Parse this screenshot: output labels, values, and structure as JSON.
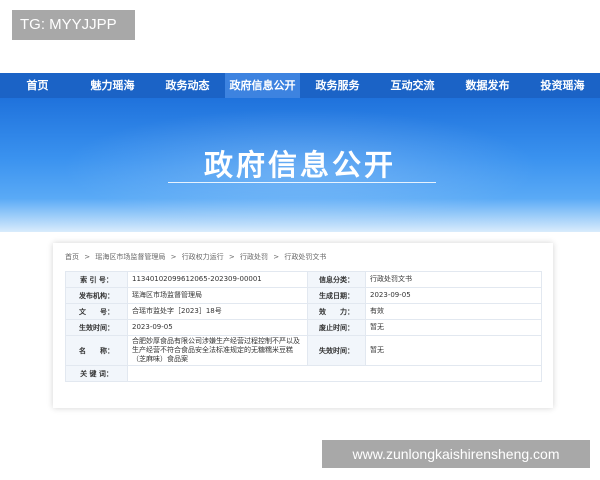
{
  "watermark_top": "TG: MYYJJPP",
  "watermark_bottom": "www.zunlongkaishirensheng.com",
  "nav": [
    "首页",
    "魅力瑶海",
    "政务动态",
    "政府信息公开",
    "政务服务",
    "互动交流",
    "数据发布",
    "投资瑶海"
  ],
  "banner": {
    "title": "政府信息公开"
  },
  "breadcrumb": [
    "首页",
    ">",
    "瑶海区市场监督管理局",
    ">",
    "行政权力运行",
    ">",
    "行政处罚",
    ">",
    "行政处罚文书"
  ],
  "table": {
    "rows": [
      {
        "l1": "索 引 号：",
        "v1": "11340102099612065-202309-00001",
        "l2": "信息分类：",
        "v2": "行政处罚文书"
      },
      {
        "l1": "发布机构：",
        "v1": "瑶海区市场监督管理局",
        "l2": "生成日期：",
        "v2": "2023-09-05"
      },
      {
        "l1": "文　　号：",
        "v1": "合瑶市监处字［2023］18号",
        "l2": "效　　力：",
        "v2": "有效"
      },
      {
        "l1": "生效时间：",
        "v1": "2023-09-05",
        "l2": "废止时间：",
        "v2": "暂无"
      },
      {
        "l1": "名　　称：",
        "v1": "合肥妙厚食品有限公司涉嫌生产经营过程控制不严以及生产经营不符合食品安全法标准规定的无糖糯米豆糕（芝麻味）食品案",
        "l2": "失效时间：",
        "v2": "暂无"
      },
      {
        "l1": "关 键 词：",
        "v1": "",
        "l2": "",
        "v2": ""
      }
    ]
  },
  "colors": {
    "nav_bg": "#1b63c6",
    "nav_active": "#3d83e0",
    "banner": "#2f86e8"
  }
}
